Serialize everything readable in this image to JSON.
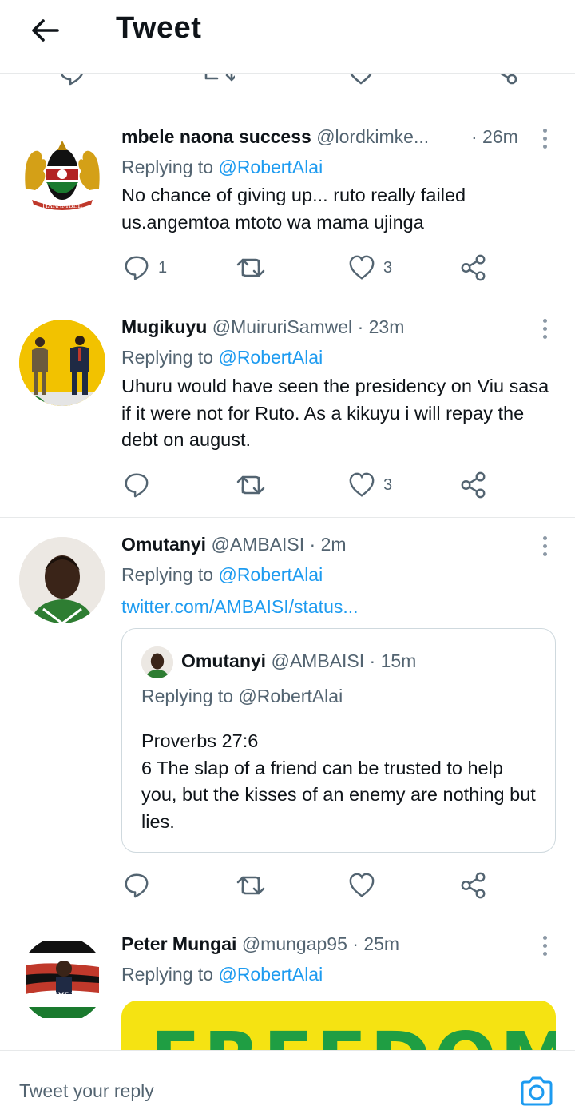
{
  "header": {
    "title": "Tweet"
  },
  "tweets": [
    {
      "display_name": "mbele naona success",
      "handle": "@lordkimke...",
      "time": "· 26m",
      "replying_prefix": "Replying to",
      "replying_to": "@RobertAlai",
      "text": "No chance of giving up... ruto really failed us.angemtoa mtoto wa mama ujinga",
      "reply_count": "1",
      "like_count": "3",
      "avatar_banner": "HARAMBEE"
    },
    {
      "display_name": "Mugikuyu",
      "handle": "@MuiruriSamwel",
      "time": "· 23m",
      "replying_prefix": "Replying to",
      "replying_to": "@RobertAlai",
      "text": "Uhuru would have seen the presidency on Viu sasa if it were not for Ruto. As a kikuyu i will repay the debt on august.",
      "reply_count": "",
      "like_count": "3"
    },
    {
      "display_name": "Omutanyi",
      "handle": "@AMBAISI",
      "time": "· 2m",
      "replying_prefix": "Replying to",
      "replying_to": "@RobertAlai",
      "link": "twitter.com/AMBAISI/status...",
      "reply_count": "",
      "like_count": "",
      "quote": {
        "display_name": "Omutanyi",
        "handle": "@AMBAISI",
        "time": "· 15m",
        "replying": "Replying to @RobertAlai",
        "line1": "Proverbs 27:6",
        "line2": "6 The slap of a friend can be trusted to help you, but the kisses of an enemy are nothing but lies."
      }
    },
    {
      "display_name": "Peter Mungai",
      "handle": "@mungap95",
      "time": "· 25m",
      "replying_prefix": "Replying to",
      "replying_to": "@RobertAlai",
      "avatar_text": "I HAVE TO",
      "media_text": "FREEDOM"
    }
  ],
  "reply_bar": {
    "placeholder": "Tweet your reply"
  },
  "icons": {
    "back": "arrow-left-icon",
    "reply": "speech-bubble-icon",
    "retweet": "retweet-icon",
    "like": "heart-icon",
    "share": "share-icon",
    "more": "more-vertical-icon",
    "camera": "camera-icon"
  },
  "colors": {
    "link": "#1d9bf0",
    "secondary_text": "#536471",
    "media_bg": "#f5e312",
    "media_text": "#1f9e43"
  }
}
